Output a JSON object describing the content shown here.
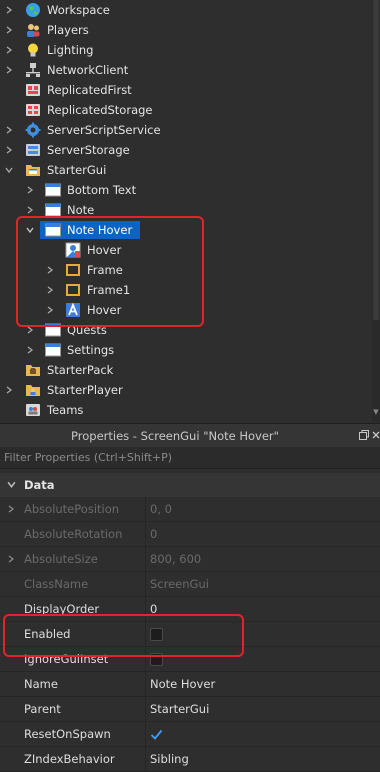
{
  "explorer": {
    "items": [
      {
        "label": "Workspace",
        "icon": "globe-icon"
      },
      {
        "label": "Players",
        "icon": "players-icon"
      },
      {
        "label": "Lighting",
        "icon": "lightbulb-icon"
      },
      {
        "label": "NetworkClient",
        "icon": "network-icon"
      },
      {
        "label": "ReplicatedFirst",
        "icon": "replicated-first-icon"
      },
      {
        "label": "ReplicatedStorage",
        "icon": "replicated-storage-icon"
      },
      {
        "label": "ServerScriptService",
        "icon": "server-script-service-icon"
      },
      {
        "label": "ServerStorage",
        "icon": "server-storage-icon"
      },
      {
        "label": "StarterGui",
        "icon": "folder-gui-icon"
      },
      {
        "label": "Bottom Text",
        "icon": "screengui-icon"
      },
      {
        "label": "Note",
        "icon": "screengui-icon"
      },
      {
        "label": "Note Hover",
        "icon": "screengui-icon",
        "selected": true
      },
      {
        "label": "Hover",
        "icon": "imagelabel-icon"
      },
      {
        "label": "Frame",
        "icon": "frame-icon"
      },
      {
        "label": "Frame1",
        "icon": "frame-icon"
      },
      {
        "label": "Hover",
        "icon": "textlabel-icon"
      },
      {
        "label": "Quests",
        "icon": "screengui-icon"
      },
      {
        "label": "Settings",
        "icon": "screengui-icon"
      },
      {
        "label": "StarterPack",
        "icon": "folder-pack-icon"
      },
      {
        "label": "StarterPlayer",
        "icon": "starter-player-icon"
      },
      {
        "label": "Teams",
        "icon": "teams-icon"
      }
    ]
  },
  "properties": {
    "title": "Properties - ScreenGui \"Note Hover\"",
    "filter_placeholder": "Filter Properties (Ctrl+Shift+P)",
    "section": "Data",
    "rows": [
      {
        "name": "AbsolutePosition",
        "value": "0, 0",
        "disabled": true
      },
      {
        "name": "AbsoluteRotation",
        "value": "0",
        "disabled": true
      },
      {
        "name": "AbsoluteSize",
        "value": "800, 600",
        "disabled": true
      },
      {
        "name": "ClassName",
        "value": "ScreenGui",
        "disabled": true
      },
      {
        "name": "DisplayOrder",
        "value": "0",
        "disabled": false
      },
      {
        "name": "Enabled",
        "value": "",
        "checked": false
      },
      {
        "name": "IgnoreGuiInset",
        "value": "",
        "checked": false
      },
      {
        "name": "Name",
        "value": "Note Hover",
        "disabled": false
      },
      {
        "name": "Parent",
        "value": "StarterGui",
        "disabled": false
      },
      {
        "name": "ResetOnSpawn",
        "value": "",
        "checked": true
      },
      {
        "name": "ZIndexBehavior",
        "value": "Sibling",
        "disabled": false
      }
    ]
  },
  "colors": {
    "selection": "#0b63c4",
    "highlight": "#e0242c",
    "checkmark": "#3f9ef5"
  }
}
